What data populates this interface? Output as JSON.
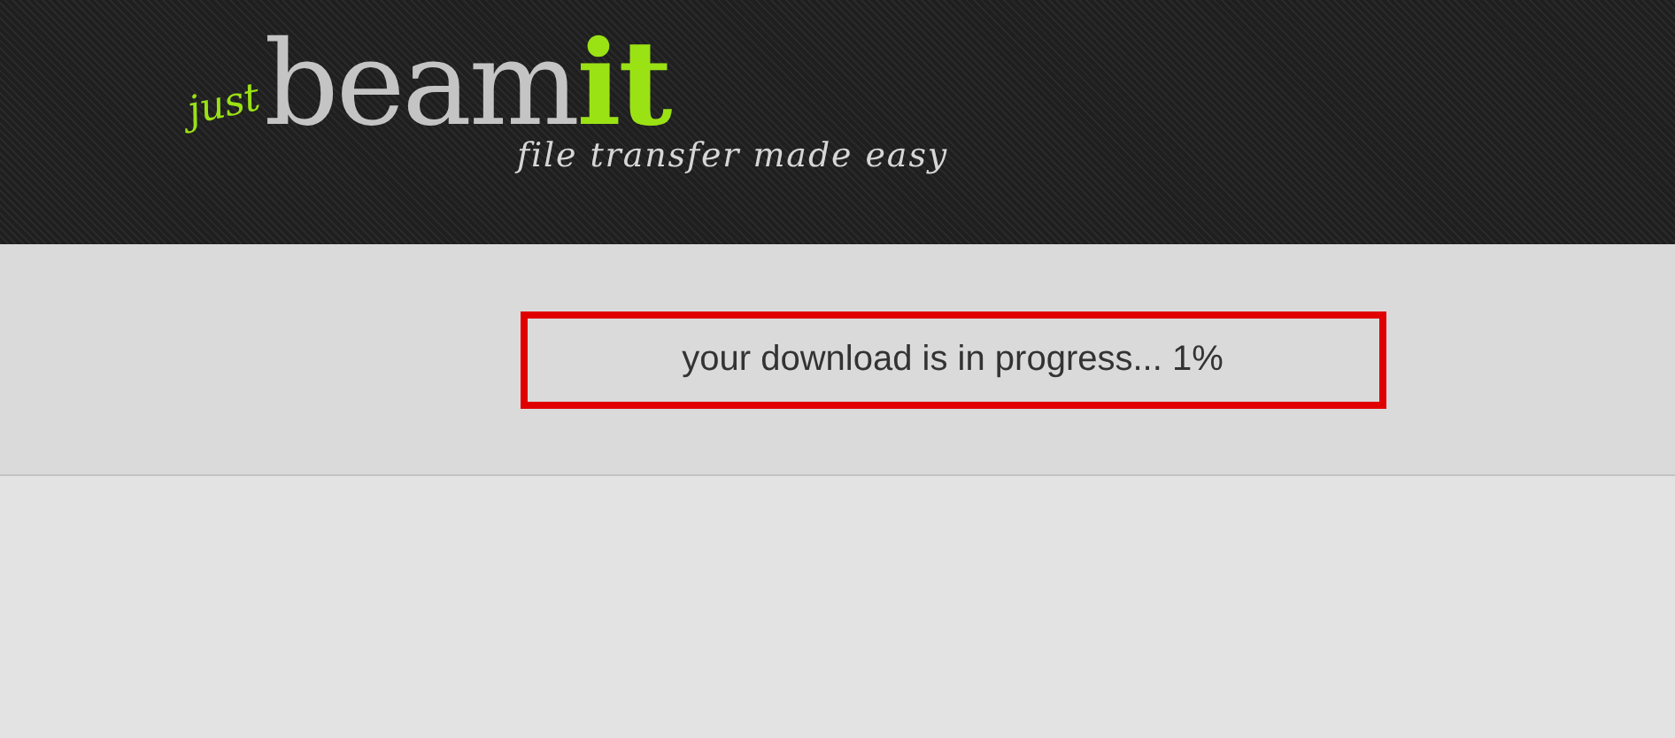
{
  "header": {
    "logo": {
      "prefix": "just",
      "name": "beam",
      "accent": "it",
      "tagline": "file transfer made easy"
    }
  },
  "status": {
    "message": "your download is in progress... 1%",
    "highlighted": true
  }
}
